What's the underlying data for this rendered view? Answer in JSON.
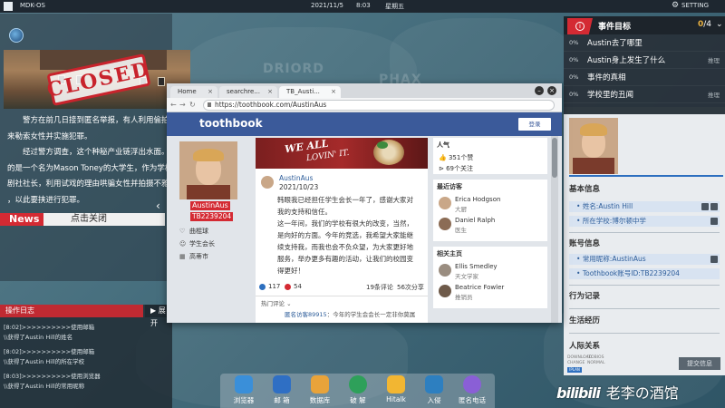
{
  "topbar": {
    "os_name": "MDK-OS",
    "date": "2021/11/5",
    "time": "8:03",
    "weekday": "星期五",
    "setting_label": "SETTING"
  },
  "news": {
    "stamp": "CLOSED",
    "paragraphs": [
      "警方在前几日接到匿名举报，有人利用偷拍",
      "来勒索女性并实施犯罪。",
      "经过警方调查，这个种秘产业链浮出水面。",
      "的是一个名为Mason Toney的大学生，作为学校",
      "剧社社长，利用试戏的理由哄骗女性并拍摄不雅",
      "，以此要挟进行犯罪。"
    ],
    "label": "News",
    "close_text": "点击关闭"
  },
  "map_labels": [
    "DRIORD",
    "PHAX"
  ],
  "oplog": {
    "title": "操作日志",
    "expand": "展开",
    "entries": [
      {
        "line1": "[8:02]>>>>>>>>>>使用邮箱",
        "line2": "\\\\获得了Austin Hill的姓名"
      },
      {
        "line1": "[8:02]>>>>>>>>>>使用邮箱",
        "line2": "\\\\获得了Austin Hill的所在学校"
      },
      {
        "line1": "[8:03]>>>>>>>>>>使用浏览器",
        "line2": "\\\\获得了Austin Hill的常用昵称"
      }
    ]
  },
  "objectives": {
    "title": "事件目标",
    "count_done": "0",
    "count_total": "/4",
    "items": [
      {
        "pct": "0%",
        "text": "Austin去了哪里",
        "tag": ""
      },
      {
        "pct": "0%",
        "text": "Austin身上发生了什么",
        "tag": "推理"
      },
      {
        "pct": "0%",
        "text": "事件的真相",
        "tag": ""
      },
      {
        "pct": "0%",
        "text": "学校里的丑闻",
        "tag": "推理"
      }
    ]
  },
  "profile": {
    "basic_title": "基本信息",
    "basic_rows": [
      "姓名:Austin Hill",
      "所在学校:博尔顿中学"
    ],
    "account_title": "账号信息",
    "account_rows": [
      "常用昵称:AustinAus",
      "Toothbook账号ID:TB2239204"
    ],
    "sections": [
      "行为记录",
      "生活经历",
      "人际关系"
    ],
    "submit": "提交信息",
    "tiny_badge": "IPLAN",
    "tiny_tags": [
      "DOWNLOAD",
      "ITOBIOS",
      "CHANGE",
      "NORMAL"
    ]
  },
  "browser": {
    "tabs": [
      "Home",
      "searchre...",
      "TB_Austi..."
    ],
    "url": "https://toothbook.com/AustinAus",
    "logo": "toothbook",
    "login": "登录",
    "user": {
      "name": "AustinAus",
      "id": "TB2239204",
      "meta": [
        "曲棍球",
        "学生会长",
        "高蒂市"
      ]
    },
    "banner_line1": "WE ALL",
    "banner_line2": "LOVIN' IT.",
    "post": {
      "author": "AustinAus",
      "date": "2021/10/23",
      "lines": [
        "韩眼我已经担任学生会长一年了，感谢大家对",
        "我的支持和信任。",
        "这一年间，我们的学校有很大的改变，当然，",
        "是向好的方面。今年的竞选，我希望大家能继",
        "续支持我，而我也会不负众望，为大家更好地",
        "服务，举办更多有趣的活动，让我们的校园变",
        "得更好！"
      ],
      "likes": "117",
      "hearts": "54",
      "comments": "19条评论",
      "shares": "56次分享",
      "hot_label": "热门评论",
      "hot_name": "匿名访客89915",
      "hot_text": "：今年的学生会会长一定非你莫属"
    },
    "popularity": {
      "title": "人气",
      "likes": "351个赞",
      "followers": "69个关注"
    },
    "visitors": {
      "title": "最近访客",
      "list": [
        {
          "name": "Erica Hodgson",
          "role": "大厨"
        },
        {
          "name": "Daniel Ralph",
          "role": "医生"
        }
      ]
    },
    "related": {
      "title": "相关主页",
      "list": [
        {
          "name": "Ellis Smedley",
          "role": "天文学家"
        },
        {
          "name": "Beatrice Fowler",
          "role": "推销员"
        }
      ]
    }
  },
  "dock": [
    {
      "label": "浏览器",
      "color": "#3a8fd9"
    },
    {
      "label": "邮 箱",
      "color": "#2f6fc4"
    },
    {
      "label": "数据库",
      "color": "#e8a33a"
    },
    {
      "label": "破 解",
      "color": "#2ea05a"
    },
    {
      "label": "Hitalk",
      "color": "#f2b632"
    },
    {
      "label": "入侵",
      "color": "#2d7fc0"
    },
    {
      "label": "匿名电话",
      "color": "#8a5fd6"
    }
  ],
  "watermark": {
    "brand": "bilibili",
    "channel": "老李の酒馆"
  }
}
